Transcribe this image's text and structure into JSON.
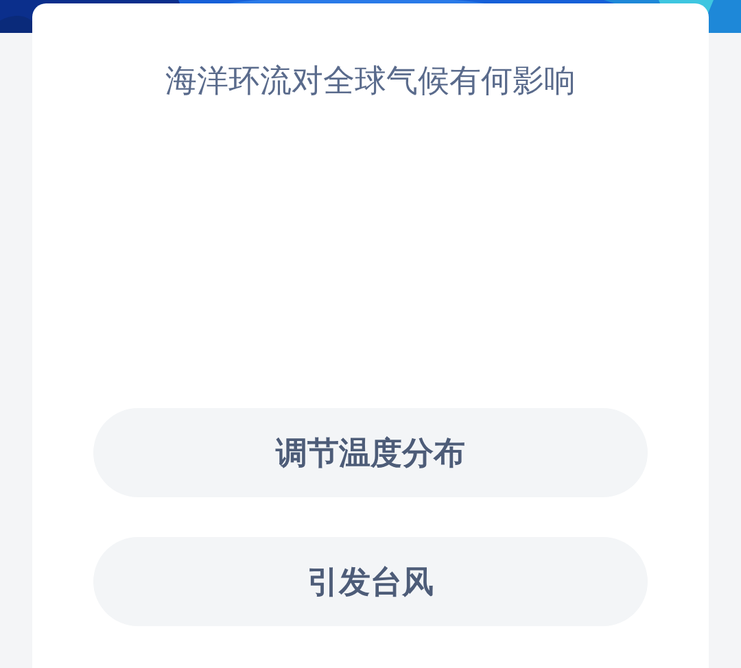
{
  "question": {
    "title": "海洋环流对全球气候有何影响"
  },
  "options": [
    {
      "label": "调节温度分布"
    },
    {
      "label": "引发台风"
    }
  ]
}
